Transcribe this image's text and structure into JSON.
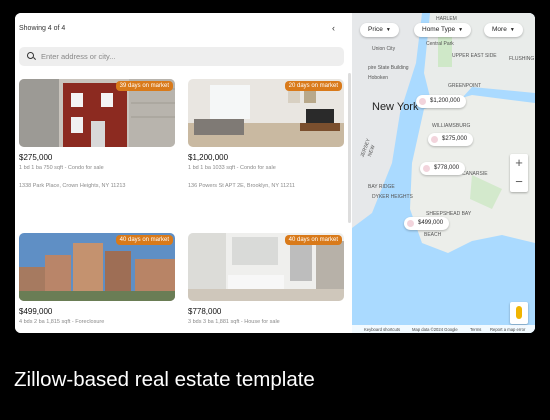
{
  "list": {
    "showing": "Showing 4 of 4",
    "collapse_icon": "chevron-left-icon",
    "search_placeholder": "Enter address or city...",
    "listings": [
      {
        "badge": "39 days on market",
        "price": "$275,000",
        "meta": "1 bd 1 ba 750 sqft - Condo for sale",
        "address": "1338 Park Place, Crown Heights, NY 11213"
      },
      {
        "badge": "20 days on market",
        "price": "$1,200,000",
        "meta": "1 bd 1 ba 1033 sqft - Condo for sale",
        "address": "136 Powers St APT 2E, Brooklyn, NY 11211"
      },
      {
        "badge": "40 days on market",
        "price": "$499,000",
        "meta": "4 bds 2 ba 1,815 sqft - Foreclosure",
        "address": ""
      },
      {
        "badge": "40 days on market",
        "price": "$778,000",
        "meta": "3 bds 3 ba 1,881 sqft - House for sale",
        "address": ""
      }
    ]
  },
  "map": {
    "filters": [
      "Price",
      "Home Type",
      "More"
    ],
    "markers": [
      "$1,200,000",
      "$275,000",
      "$778,000",
      "$499,000"
    ],
    "labels": [
      "HARLEM",
      "Union City",
      "Central Park",
      "UPPER EAST SIDE",
      "pire State Building",
      "Hoboken",
      "New York",
      "JERSEY",
      "NEW",
      "GREENPOINT",
      "FLUSHING",
      "WILLIAMSBURG",
      "BAY RIDGE",
      "DYKER HEIGHTS",
      "SHEEPSHEAD BAY",
      "BEACH",
      "BRIGHTON",
      "CANARSIE"
    ],
    "zoom_in": "+",
    "zoom_out": "−",
    "footer": [
      "Keyboard shortcuts",
      "Map data ©2024 Google",
      "Terms",
      "Report a map error"
    ]
  },
  "caption": "Zillow-based real estate template"
}
